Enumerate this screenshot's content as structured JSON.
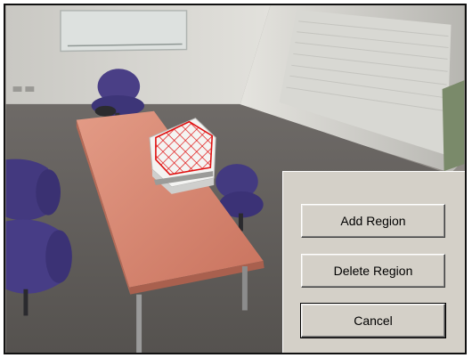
{
  "dialog": {
    "add_region_label": "Add Region",
    "delete_region_label": "Delete Region",
    "cancel_label": "Cancel"
  },
  "colors": {
    "region_outline": "#e01010",
    "panel_bg": "#d4d0c8",
    "table_top": "#d9826e"
  },
  "camera_view": {
    "scene": "meeting room with table, chairs, and box",
    "selected_region_color": "red crosshatch"
  }
}
